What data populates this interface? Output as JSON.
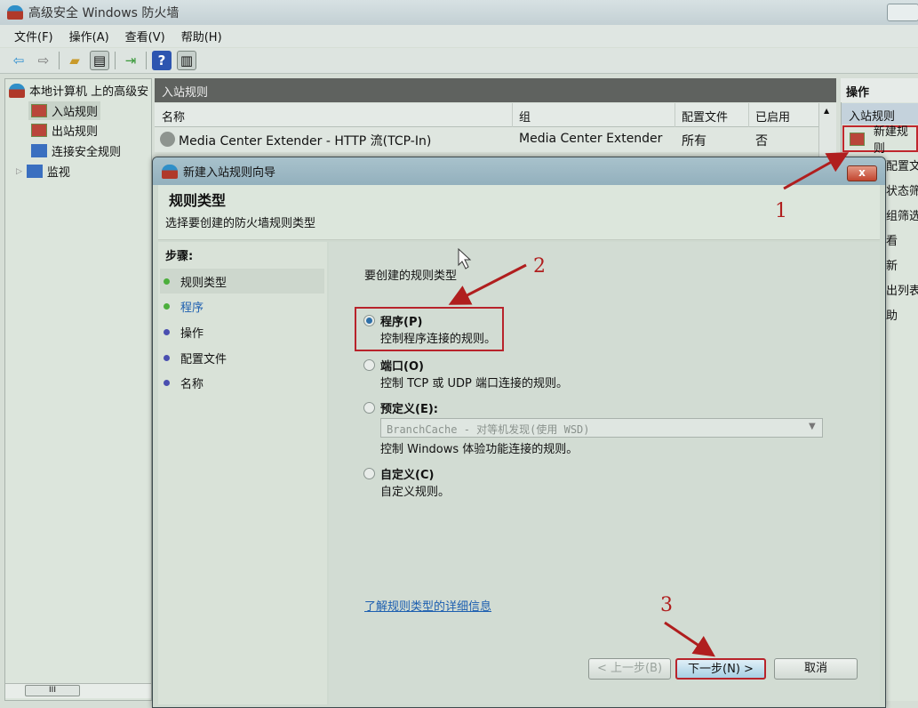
{
  "window": {
    "title": "高级安全 Windows 防火墙"
  },
  "menu": [
    "文件(F)",
    "操作(A)",
    "查看(V)",
    "帮助(H)"
  ],
  "tree": {
    "root": "本地计算机 上的高级安",
    "items": [
      "入站规则",
      "出站规则",
      "连接安全规则",
      "监视"
    ],
    "scroll_thumb": "III"
  },
  "center": {
    "header": "入站规则",
    "columns": [
      "名称",
      "组",
      "配置文件",
      "已启用"
    ],
    "rows": [
      {
        "name": "Media Center Extender - HTTP 流(TCP-In)",
        "group": "Media Center Extender",
        "profile": "所有",
        "enabled": "否"
      }
    ]
  },
  "actions": {
    "header": "操作",
    "section": "入站规则",
    "items": [
      "新建规则",
      "配置文",
      "状态筛",
      "组筛选",
      "看",
      "新",
      "出列表",
      "助"
    ]
  },
  "dialog": {
    "title": "新建入站规则向导",
    "close": "x",
    "heading": "规则类型",
    "subheading": "选择要创建的防火墙规则类型",
    "steps_title": "步骤:",
    "steps": [
      {
        "label": "规则类型",
        "color": "#4caf3c"
      },
      {
        "label": "程序",
        "color": "#4caf3c"
      },
      {
        "label": "操作",
        "color": "#4a4fb0"
      },
      {
        "label": "配置文件",
        "color": "#4a4fb0"
      },
      {
        "label": "名称",
        "color": "#4a4fb0"
      }
    ],
    "prompt": "要创建的规则类型",
    "options": [
      {
        "title": "程序(P)",
        "desc": "控制程序连接的规则。",
        "selected": true
      },
      {
        "title": "端口(O)",
        "desc": "控制 TCP 或 UDP 端口连接的规则。",
        "selected": false
      },
      {
        "title": "预定义(E):",
        "desc": "控制 Windows 体验功能连接的规则。",
        "selected": false,
        "select_value": "BranchCache - 对等机发现(使用 WSD)"
      },
      {
        "title": "自定义(C)",
        "desc": "自定义规则。",
        "selected": false
      }
    ],
    "learn_more": "了解规则类型的详细信息",
    "buttons": {
      "back": "< 上一步(B)",
      "next": "下一步(N) >",
      "cancel": "取消"
    }
  },
  "annotations": {
    "labels": [
      "1",
      "2",
      "3"
    ],
    "color": "#b01e1e"
  }
}
